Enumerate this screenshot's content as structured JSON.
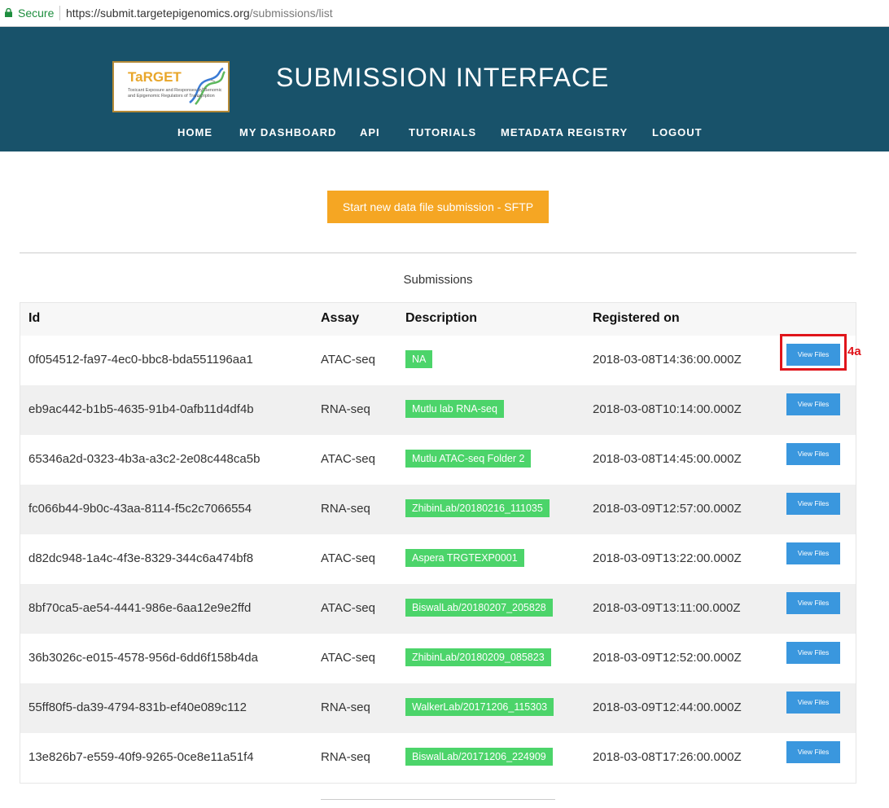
{
  "browser": {
    "secure_label": "Secure",
    "url_host": "https://submit.targetepigenomics.org",
    "url_path": "/submissions/list"
  },
  "header": {
    "logo_brand": "TaRGET",
    "logo_tagline": "Toxicant Exposure and Responses by Genomic and Epigenomic Regulators of Transcription",
    "title": "SUBMISSION INTERFACE",
    "nav": [
      "HOME",
      "MY DASHBOARD",
      "API",
      "TUTORIALS",
      "METADATA REGISTRY",
      "LOGOUT"
    ]
  },
  "main": {
    "cta_label": "Start new data file submission - SFTP",
    "section_title": "Submissions",
    "columns": [
      "Id",
      "Assay",
      "Description",
      "Registered on"
    ],
    "button_label": "View Files",
    "annotation": "4a",
    "rows": [
      {
        "id": "0f054512-fa97-4ec0-bbc8-bda551196aa1",
        "assay": "ATAC-seq",
        "desc": "NA",
        "date": "2018-03-08T14:36:00.000Z"
      },
      {
        "id": "eb9ac442-b1b5-4635-91b4-0afb11d4df4b",
        "assay": "RNA-seq",
        "desc": "Mutlu lab RNA-seq",
        "date": "2018-03-08T10:14:00.000Z"
      },
      {
        "id": "65346a2d-0323-4b3a-a3c2-2e08c448ca5b",
        "assay": "ATAC-seq",
        "desc": "Mutlu ATAC-seq Folder 2",
        "date": "2018-03-08T14:45:00.000Z"
      },
      {
        "id": "fc066b44-9b0c-43aa-8114-f5c2c7066554",
        "assay": "RNA-seq",
        "desc": "ZhibinLab/20180216_111035",
        "date": "2018-03-09T12:57:00.000Z"
      },
      {
        "id": "d82dc948-1a4c-4f3e-8329-344c6a474bf8",
        "assay": "ATAC-seq",
        "desc": "Aspera TRGTEXP0001",
        "date": "2018-03-09T13:22:00.000Z"
      },
      {
        "id": "8bf70ca5-ae54-4441-986e-6aa12e9e2ffd",
        "assay": "ATAC-seq",
        "desc": "BiswalLab/20180207_205828",
        "date": "2018-03-09T13:11:00.000Z"
      },
      {
        "id": "36b3026c-e015-4578-956d-6dd6f158b4da",
        "assay": "ATAC-seq",
        "desc": "ZhibinLab/20180209_085823",
        "date": "2018-03-09T12:52:00.000Z"
      },
      {
        "id": "55ff80f5-da39-4794-831b-ef40e089c112",
        "assay": "RNA-seq",
        "desc": "WalkerLab/20171206_115303",
        "date": "2018-03-09T12:44:00.000Z"
      },
      {
        "id": "13e826b7-e559-40f9-9265-0ce8e11a51f4",
        "assay": "RNA-seq",
        "desc": "BiswalLab/20171206_224909",
        "date": "2018-03-08T17:26:00.000Z"
      }
    ]
  },
  "colors": {
    "header_bg": "#18526a",
    "cta": "#f5a623",
    "badge": "#4cd46a",
    "button": "#3a97de",
    "annotation": "#e0151b"
  }
}
